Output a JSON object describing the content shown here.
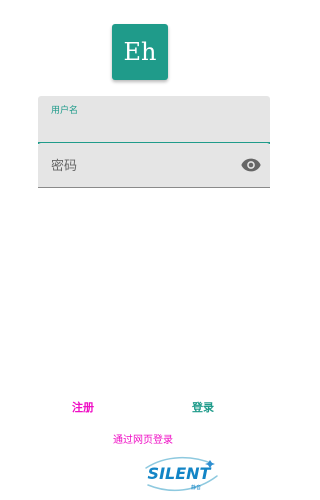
{
  "app": {
    "logo_text": "Eh"
  },
  "form": {
    "username_label": "用户名",
    "username_value": "",
    "password_placeholder": "密码",
    "password_value": ""
  },
  "actions": {
    "register_label": "注册",
    "login_label": "登录",
    "web_login_label": "通过网页登录"
  },
  "watermark": {
    "text": "SILENT",
    "subtext": "静音"
  },
  "colors": {
    "accent": "#1f9b8a",
    "link": "#ef0fc5",
    "field_background": "#e5e5e5"
  },
  "icons": {
    "password_visibility": "eye-icon"
  }
}
